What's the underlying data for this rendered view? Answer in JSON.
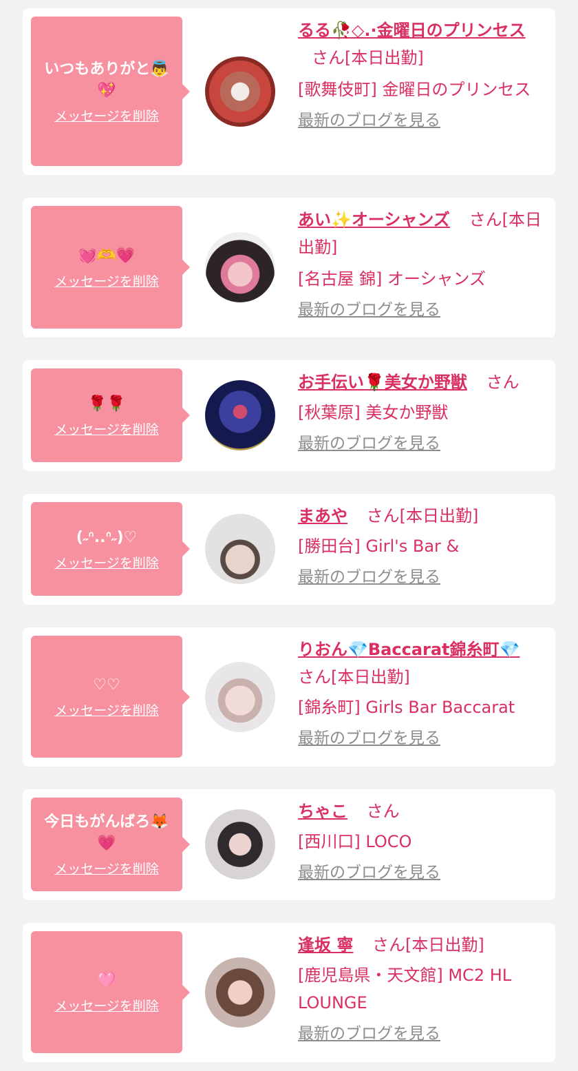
{
  "delete_label": "メッセージを削除",
  "blog_label": "最新のブログを見る",
  "colors": {
    "bubble": "#f7919f",
    "name": "#d92f61",
    "link_gray": "#8c8c8c",
    "background": "#f2f2f2"
  },
  "cards": [
    {
      "message": "いつもありがと👼💖",
      "name": "るる🥀◇.·金曜日のプリンセス",
      "suffix": "さん[本日出勤]",
      "shop": "[歌舞伎町] 金曜日のプリンセス",
      "avatar": "avatar-photo"
    },
    {
      "message": "💓🫶💗",
      "name": "あい✨オーシャンズ",
      "suffix": "さん[本日出勤]",
      "shop": "[名古屋 錦] オーシャンズ",
      "avatar": "avatar-photo"
    },
    {
      "message": "🌹🌹",
      "name": "お手伝い🌹美女か野獣",
      "suffix": "さん",
      "shop": "[秋葉原] 美女か野獣",
      "avatar": "avatar-rose"
    },
    {
      "message": "(˶ᐢ..ᐢ˶)♡",
      "name": "まあや",
      "suffix": "さん[本日出勤]",
      "shop": "[勝田台] Girl's Bar &",
      "avatar": "avatar-photo"
    },
    {
      "message": "♡♡",
      "name": "りおん💎Baccarat錦糸町💎",
      "suffix": "さん[本日出勤]",
      "shop": "[錦糸町] Girls Bar Baccarat",
      "avatar": "avatar-photo"
    },
    {
      "message": "今日もがんばろ🦊💗",
      "name": "ちゃこ",
      "suffix": "さん",
      "shop": "[西川口] LOCO",
      "avatar": "avatar-photo"
    },
    {
      "message": "🩷",
      "name": "逢坂 寧",
      "suffix": "さん[本日出勤]",
      "shop": "[鹿児島県・天文館] MC2 HL LOUNGE",
      "avatar": "avatar-photo"
    }
  ]
}
